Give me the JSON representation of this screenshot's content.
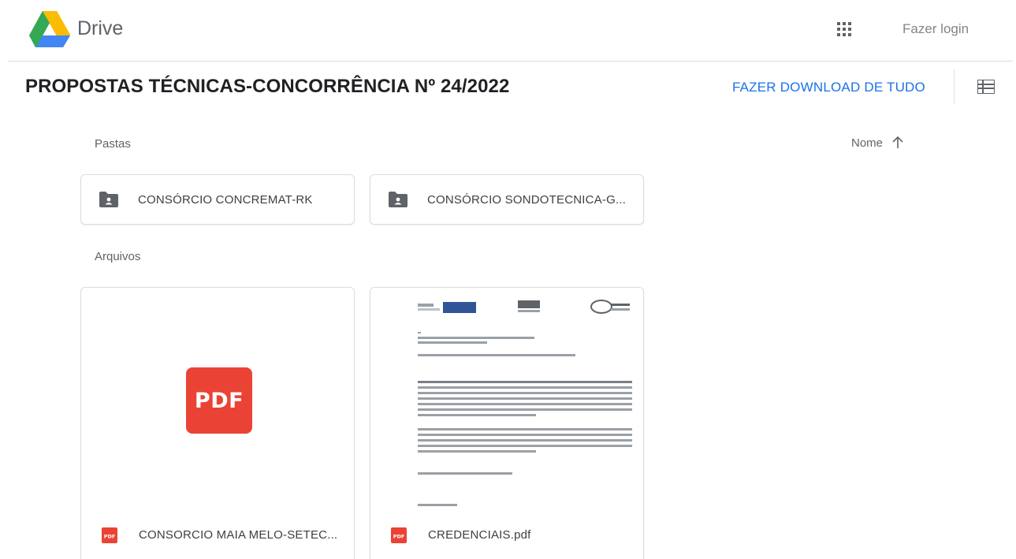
{
  "header": {
    "brand": "Drive",
    "login_label": "Fazer login"
  },
  "toolbar": {
    "title": "PROPOSTAS TÉCNICAS-CONCORRÊNCIA Nº 24/2022",
    "download_all_label": "FAZER DOWNLOAD DE TUDO"
  },
  "sort": {
    "label": "Nome"
  },
  "sections": {
    "folders_label": "Pastas",
    "files_label": "Arquivos"
  },
  "folders": [
    {
      "name": "CONSÓRCIO CONCREMAT-RK"
    },
    {
      "name": "CONSÓRCIO SONDOTECNICA-G..."
    }
  ],
  "files": [
    {
      "name": "CONSORCIO MAIA MELO-SETEC...",
      "thumbnail_label": "PDF"
    },
    {
      "name": "CREDENCIAIS.pdf"
    }
  ],
  "colors": {
    "accent": "#1a73e8",
    "pdf_red": "#ea4335",
    "border": "#dadce0",
    "text_secondary": "#5f6368"
  },
  "icons": {
    "logo": "google-drive-logo",
    "apps": "apps-grid-icon",
    "list_view": "list-view-icon",
    "sort": "arrow-up-icon",
    "folder": "shared-folder-icon",
    "file": "pdf-file-icon"
  }
}
